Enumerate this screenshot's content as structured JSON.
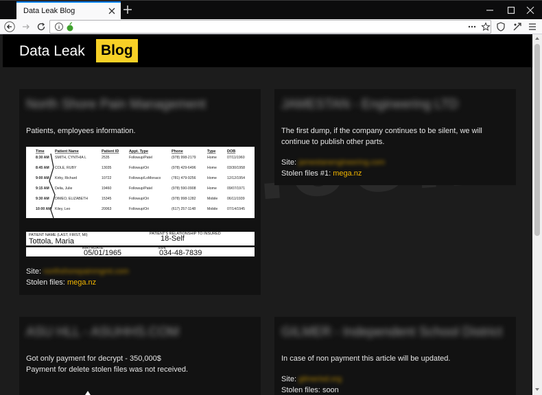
{
  "browser": {
    "tab_title": "Data Leak Blog"
  },
  "header": {
    "logo_text": "Data Leak",
    "logo_badge": "Blog"
  },
  "watermark": "risk.com",
  "cards": [
    {
      "title": "North Shore Pain Management",
      "description": "Patients, employees information.",
      "site_label": "Site:",
      "site_value": "northshorepainmgmt.com",
      "files_label": "Stolen files:",
      "files_value": "mega.nz",
      "doc": {
        "headers": [
          "Time",
          "Patient Name",
          "Patient ID",
          "Appt. Type",
          "Phone",
          "Type",
          "DOB"
        ],
        "rows": [
          [
            "8:30 AM",
            "SMITH, CYNTHIA L",
            "2535",
            "Followup/Patel",
            "(978) 998-2179",
            "Home",
            "07/11/1960"
          ],
          [
            "8:45 AM",
            "COLE, RUBY",
            "13035",
            "Followup/Ori",
            "(978) 429-6496",
            "Home",
            "03/30/1958"
          ],
          [
            "9:00 AM",
            "Kirby, Richard",
            "10722",
            "Followup/LoMonaco",
            "(781) 479-9256",
            "Home",
            "12/12/1954"
          ],
          [
            "9:15 AM",
            "Delia, Julie",
            "19460",
            "Followup/Patel",
            "(978) 590-0908",
            "Home",
            "09/07/1971"
          ],
          [
            "9:30 AM",
            "DIMEO, ELIZABETH",
            "15345",
            "Followup/Ori",
            "(978) 998-1282",
            "Mobile",
            "06/11/1939"
          ],
          [
            "10:00 AM",
            "Kiley, Leo",
            "20063",
            "Followup/Ori",
            "(617) 257-1148",
            "Mobile",
            "07/14/1945"
          ]
        ],
        "form_name_label": "PATIENT NAME (LAST, FIRST, MI)",
        "form_name": "Tottola, Maria",
        "form_rel_label": "PATIENT'S RELATIONSHIP TO INSURED",
        "form_rel": "18-Self",
        "form_dob_label": "BIRTHDATE",
        "form_dob": "05/01/1965",
        "form_ssn_label": "SSN",
        "form_ssn": "034-48-7839"
      }
    },
    {
      "title": "JAMESTAN - Engineering LTD",
      "description": "The first dump, if the company continues to be silent, we will continue to publish other parts.",
      "site_label": "Site:",
      "site_value": "jamestanengineering.com",
      "files_label": "Stolen files #1:",
      "files_value": "mega.nz"
    },
    {
      "title": "ASU HLL - ASUHHS.COM",
      "description": "Got only payment for decrypt - 350,000$\nPayment for delete stolen files was not received."
    },
    {
      "title": "GILMER - Independent School District",
      "description": "In case of non payment this article will be updated.",
      "site_label": "Site:",
      "site_value": "gilmerisd.org",
      "files_label": "Stolen files:",
      "files_value": "soon"
    }
  ],
  "colors": {
    "badge": "#f7d026",
    "link": "#f0b400",
    "card_bg": "#121212",
    "page_bg": "#1c1c1c"
  }
}
